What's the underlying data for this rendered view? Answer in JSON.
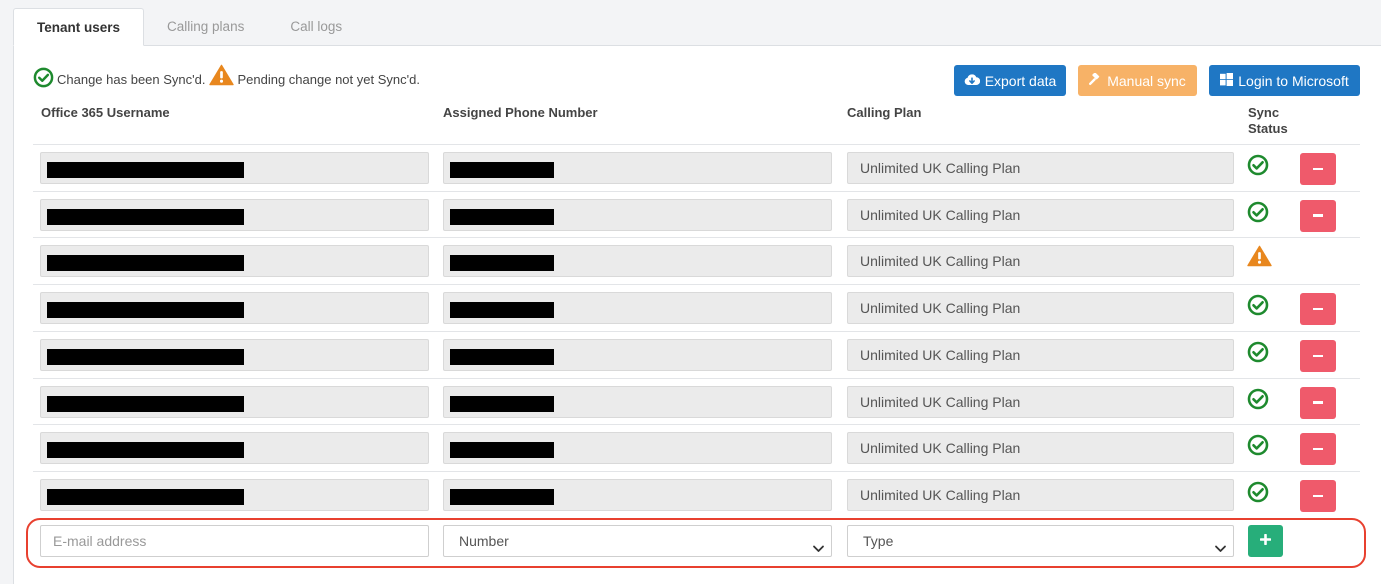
{
  "tabs": [
    {
      "label": "Tenant users",
      "active": true
    },
    {
      "label": "Calling plans",
      "active": false
    },
    {
      "label": "Call logs",
      "active": false
    }
  ],
  "legend": {
    "synced_text": "Change has been Sync'd.",
    "pending_text": "Pending change not yet Sync'd."
  },
  "toolbar": {
    "export_label": "Export data",
    "manual_sync_label": "Manual sync",
    "login_label": "Login to Microsoft"
  },
  "table": {
    "headers": {
      "username": "Office 365 Username",
      "phone": "Assigned Phone Number",
      "plan": "Calling Plan",
      "sync": "Sync Status"
    },
    "rows": [
      {
        "plan": "Unlimited UK Calling Plan",
        "status": "synced"
      },
      {
        "plan": "Unlimited UK Calling Plan",
        "status": "synced"
      },
      {
        "plan": "Unlimited UK Calling Plan",
        "status": "pending"
      },
      {
        "plan": "Unlimited UK Calling Plan",
        "status": "synced"
      },
      {
        "plan": "Unlimited UK Calling Plan",
        "status": "synced"
      },
      {
        "plan": "Unlimited UK Calling Plan",
        "status": "synced"
      },
      {
        "plan": "Unlimited UK Calling Plan",
        "status": "synced"
      },
      {
        "plan": "Unlimited UK Calling Plan",
        "status": "synced"
      }
    ]
  },
  "add_row": {
    "email_placeholder": "E-mail address",
    "number_selected": "Number",
    "type_selected": "Type"
  },
  "colors": {
    "primary": "#1f77c4",
    "warning": "#f7b267",
    "danger": "#ef5a6b",
    "success": "#27ae7a",
    "sync_ok": "#1e8a2e",
    "sync_pending": "#e8871e",
    "highlight": "#e8402f"
  }
}
